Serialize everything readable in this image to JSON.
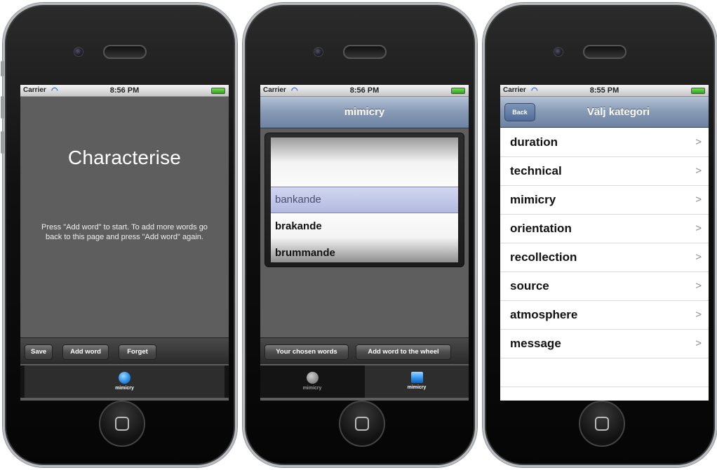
{
  "status": {
    "carrier": "Carrier",
    "time_phone1": "8:56 PM",
    "time_phone2": "8:56 PM",
    "time_phone3": "8:55 PM"
  },
  "phone1": {
    "title": "Characterise",
    "instructions": "Press \"Add word\" to start. To add more words go back to this page and press \"Add word\" again.",
    "toolbar": {
      "save": "Save",
      "add_word": "Add word",
      "forget": "Forget"
    },
    "tabs": [
      {
        "label": "mimicry"
      }
    ]
  },
  "phone2": {
    "nav_title": "mimicry",
    "picker": {
      "rows": [
        "bankande",
        "brakande",
        "brummande"
      ],
      "selected": "bankande"
    },
    "toolbar": {
      "chosen_words": "Your chosen words",
      "add_to_wheel": "Add word to the wheel"
    },
    "tabs": [
      {
        "label": "mimicry"
      },
      {
        "label": "mimicry"
      }
    ]
  },
  "phone3": {
    "back": "Back",
    "nav_title": "Välj kategori",
    "items": [
      {
        "label": "duration"
      },
      {
        "label": "technical"
      },
      {
        "label": "mimicry"
      },
      {
        "label": "orientation"
      },
      {
        "label": "recollection"
      },
      {
        "label": "source"
      },
      {
        "label": "atmosphere"
      },
      {
        "label": "message"
      }
    ],
    "chevron": ">"
  },
  "colors": {
    "nav_blue": "#8699b5",
    "screen_grey": "#5e5e5e",
    "tab_accent": "#2b8fe8"
  }
}
